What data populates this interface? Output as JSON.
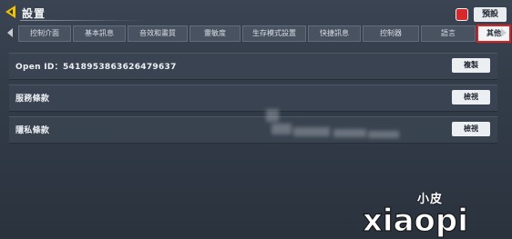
{
  "header": {
    "title": "設置",
    "preset_label": "預設",
    "back_icon": "back-arrow-icon",
    "notify_icon": "notification-icon"
  },
  "tabs": [
    {
      "label": "控制介面",
      "active": false
    },
    {
      "label": "基本訊息",
      "active": false
    },
    {
      "label": "音效和畫質",
      "active": false
    },
    {
      "label": "靈敏度",
      "active": false
    },
    {
      "label": "生存模式設置",
      "active": false
    },
    {
      "label": "快捷訊息",
      "active": false
    },
    {
      "label": "控制器",
      "active": false
    },
    {
      "label": "語言",
      "active": false
    },
    {
      "label": "其他",
      "active": true
    }
  ],
  "rows": [
    {
      "label": "Open ID：5418953863626479637",
      "button": "複製"
    },
    {
      "label": "服務條款",
      "button": "檢視"
    },
    {
      "label": "隱私條款",
      "button": "檢視"
    }
  ],
  "watermark": {
    "small_text": "小皮",
    "logo_text": "xiaopi"
  },
  "colors": {
    "active_tab_outline": "#e11e1e",
    "notification": "#d8282b",
    "back_arrow": "#f2c200"
  }
}
